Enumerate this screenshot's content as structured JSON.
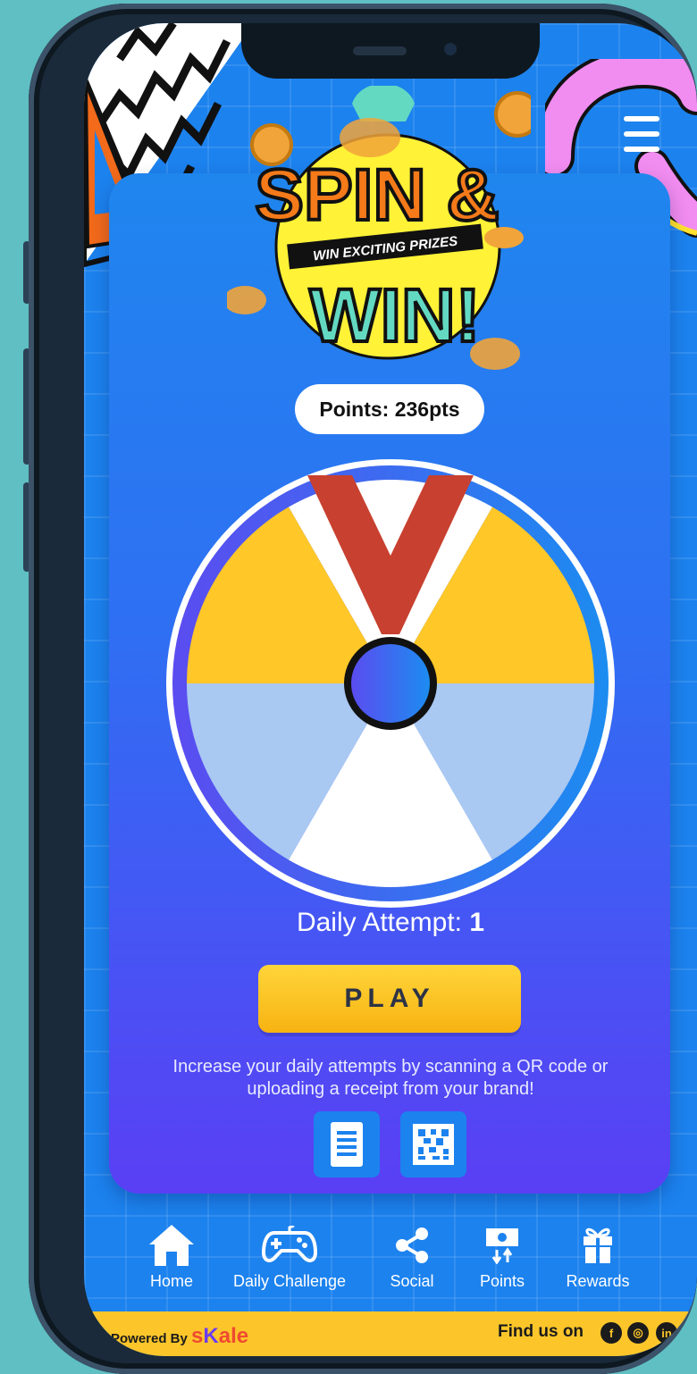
{
  "header": {
    "logo_line1": "SPIN &",
    "logo_banner": "WIN EXCITING PRIZES",
    "logo_line2": "WIN!",
    "menu_icon": "hamburger-icon"
  },
  "points": {
    "label": "Points: 236pts"
  },
  "wheel": {
    "segments": [
      {
        "color": "#ffffff"
      },
      {
        "color": "#ffc728"
      },
      {
        "color": "#a9c8f2"
      },
      {
        "color": "#ffffff"
      },
      {
        "color": "#a9c8f2"
      },
      {
        "color": "#ffc728"
      }
    ],
    "pointer_color": "#c8402f",
    "hub_color": "#3a5cf0"
  },
  "attempt": {
    "label": "Daily Attempt: ",
    "value": "1"
  },
  "play_button": {
    "label": "PLAY"
  },
  "hint": {
    "text": "Increase your daily attempts by scanning a QR code or uploading a receipt from your brand!"
  },
  "actions": [
    {
      "icon": "receipt-icon"
    },
    {
      "icon": "qr-code-icon"
    }
  ],
  "nav": {
    "items": [
      {
        "label": "Home",
        "icon": "home-icon"
      },
      {
        "label": "Daily Challenge",
        "icon": "gamepad-icon"
      },
      {
        "label": "Social",
        "icon": "share-icon"
      },
      {
        "label": "Points",
        "icon": "points-icon"
      },
      {
        "label": "Rewards",
        "icon": "gift-icon"
      }
    ]
  },
  "footer": {
    "powered_by": "Powered By",
    "brand_s": "s",
    "brand_k": "K",
    "brand_rest": "ale",
    "find_us": "Find us on",
    "socials": [
      {
        "icon": "facebook-icon",
        "glyph": "f"
      },
      {
        "icon": "instagram-icon",
        "glyph": "◎"
      },
      {
        "icon": "linkedin-icon",
        "glyph": "in"
      }
    ]
  },
  "colors": {
    "accent_yellow": "#fcc62a",
    "accent_blue": "#1c82ee",
    "accent_purple": "#5a3ff4"
  }
}
